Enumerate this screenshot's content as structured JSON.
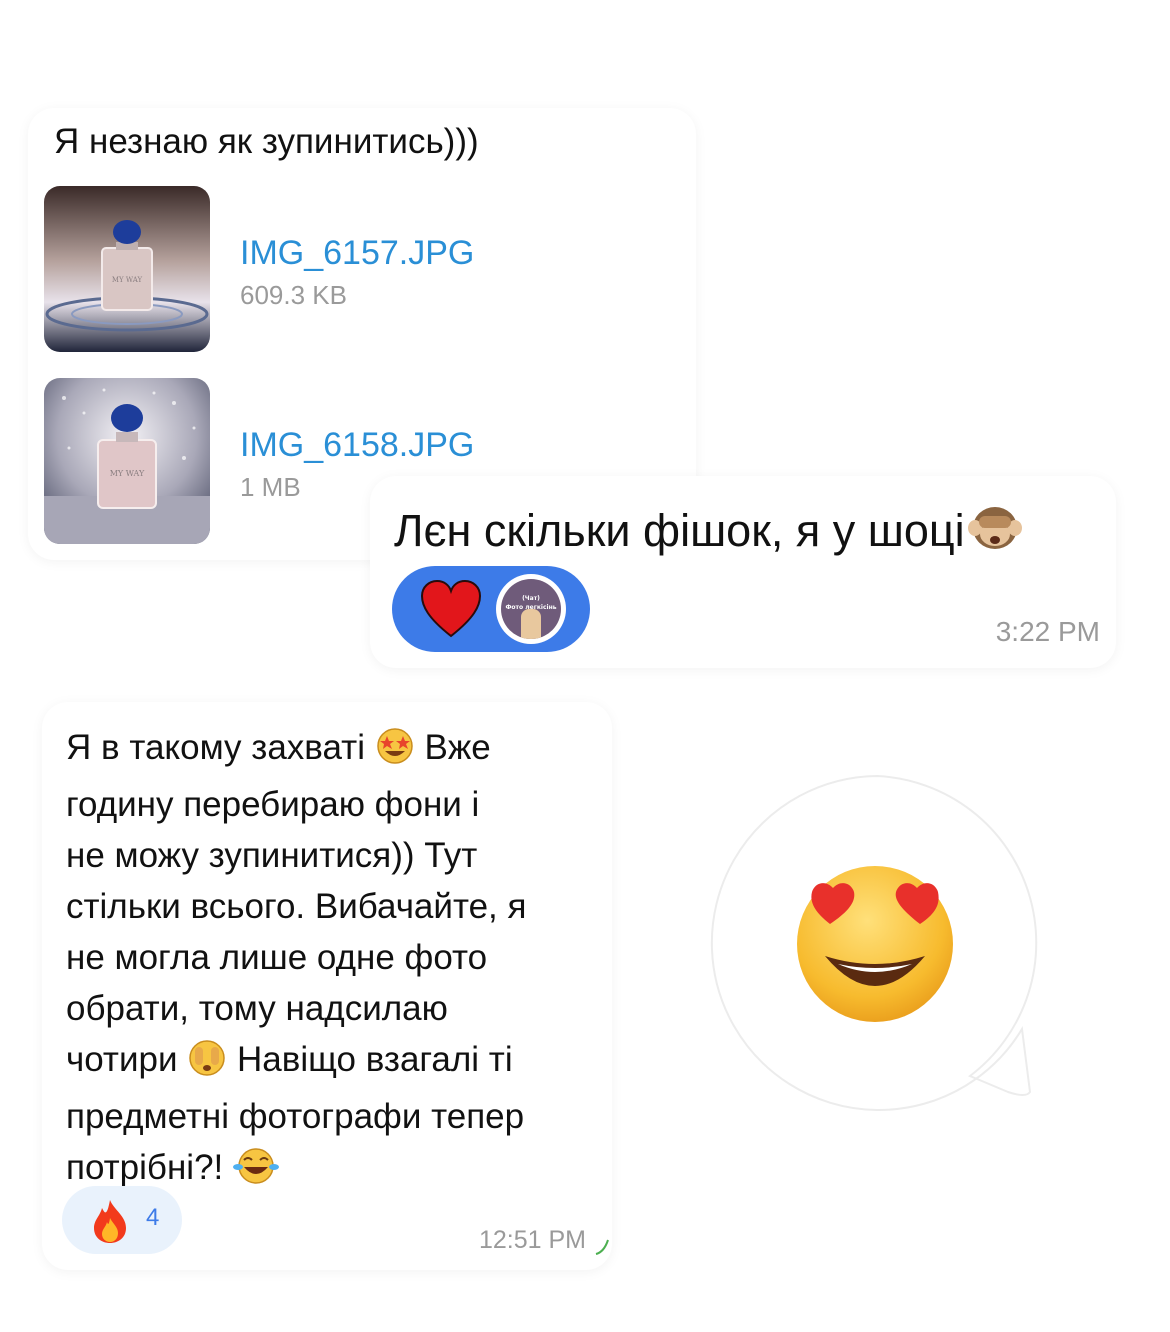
{
  "messages": {
    "msg1": {
      "caption": "Я незнаю як зупинитись)))",
      "files": [
        {
          "name": "IMG_6157.JPG",
          "size": "609.3 KB",
          "thumb_text": "MY WAY"
        },
        {
          "name": "IMG_6158.JPG",
          "size": "1 MB",
          "thumb_text": "MY WAY"
        }
      ]
    },
    "msg2": {
      "text": "Лєн скільки фішок, я у шоці",
      "reaction_emoji": "heart",
      "avatar_text": [
        "(Чат)",
        "Фото легкісінь"
      ],
      "time": "3:22 PM"
    },
    "msg3": {
      "lines": [
        "Я в такому захваті",
        "Вже",
        "годину перебираю фони і",
        "не можу зупинитися)) Тут",
        "стільки всього. Вибачайте, я",
        "не могла лише одне фото",
        "обрати, тому надсилаю",
        "чотири",
        "Навіщо взагалі ті",
        "предметні фотографи тепер",
        "потрібні?!"
      ],
      "reaction": {
        "emoji": "fire",
        "count": "4"
      },
      "time": "12:51 PM"
    },
    "sticker": {
      "emoji": "heart-eyes-face"
    }
  },
  "colors": {
    "link": "#2a8fd6",
    "reaction_blue": "#3d7be8",
    "fire_pill": "#e9f2fc",
    "time_gray": "#9a9a9a"
  }
}
